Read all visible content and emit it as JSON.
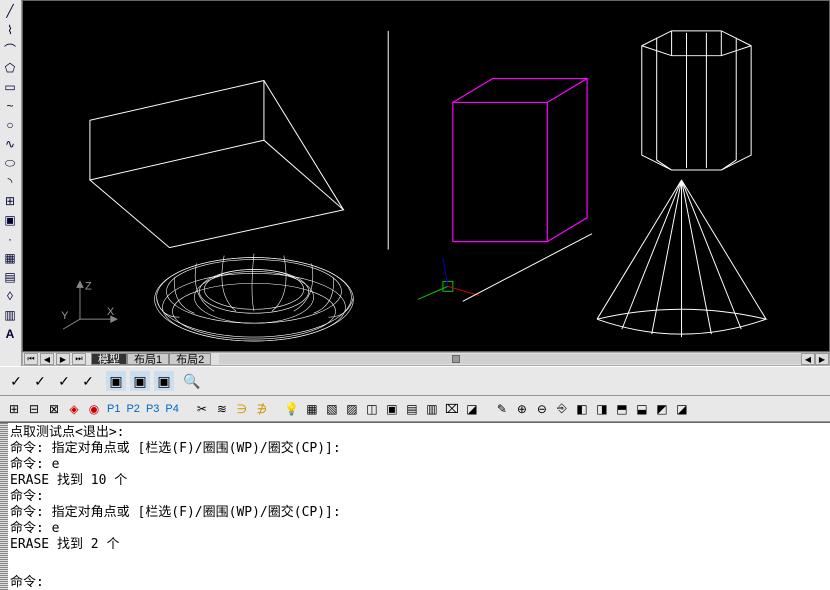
{
  "viewport": {
    "axes": {
      "z_label": "Z",
      "y_label": "Y",
      "x_label": "X"
    }
  },
  "tabs": {
    "model": "模型",
    "layout1": "布局1",
    "layout2": "布局2"
  },
  "toolbar2_labels": {
    "p1": "P1",
    "p2": "P2",
    "p3": "P3",
    "p4": "P4"
  },
  "command_history": [
    "点取测试点<退出>:",
    "命令: 指定对角点或 [栏选(F)/圈围(WP)/圈交(CP)]:",
    "命令: e",
    "ERASE 找到 10 个",
    "命令: ",
    "命令: 指定对角点或 [栏选(F)/圈围(WP)/圈交(CP)]:",
    "命令: e",
    "ERASE 找到 2 个",
    ""
  ],
  "command_prompt": "命令:",
  "command_input_value": ""
}
